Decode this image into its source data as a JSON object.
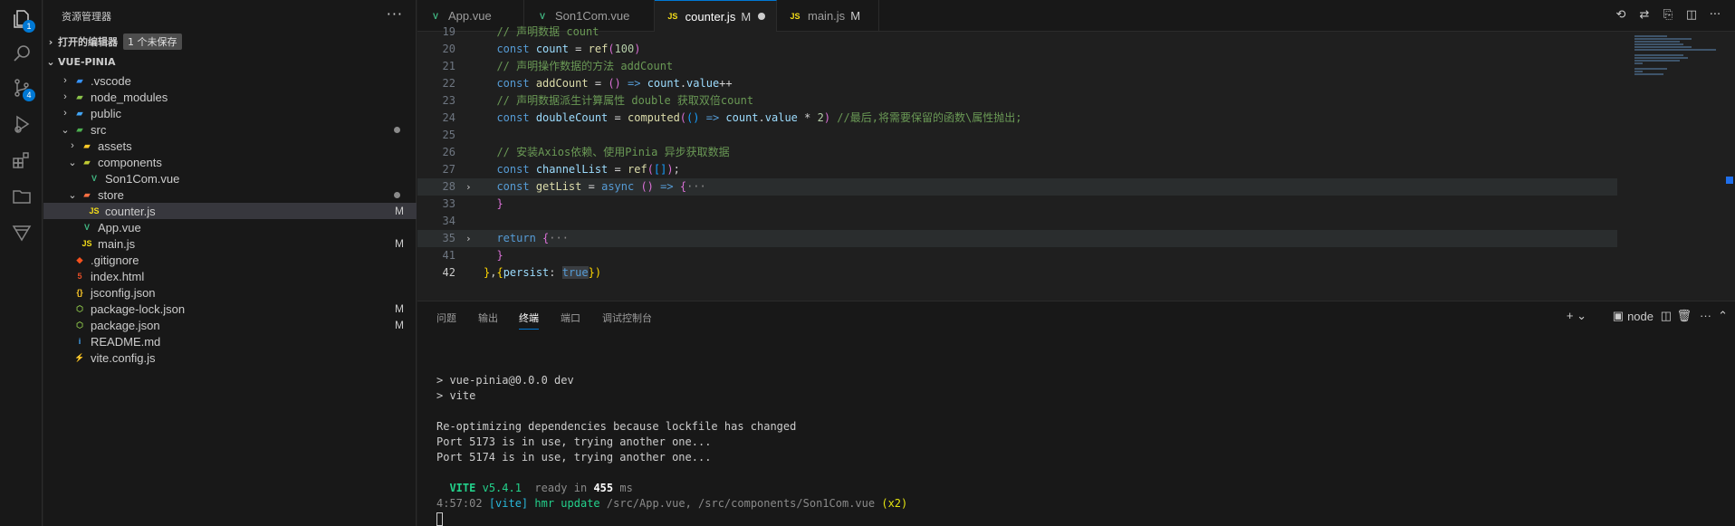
{
  "activity_bar": {
    "items": [
      {
        "icon": "files-icon",
        "badge": "1"
      },
      {
        "icon": "search-icon",
        "badge": ""
      },
      {
        "icon": "source-control-icon",
        "badge": "4"
      },
      {
        "icon": "run-debug-icon",
        "badge": ""
      },
      {
        "icon": "extensions-icon",
        "badge": ""
      },
      {
        "icon": "folder-icon",
        "badge": ""
      },
      {
        "icon": "vite-icon",
        "badge": ""
      }
    ]
  },
  "sidebar": {
    "title": "资源管理器",
    "more": "···",
    "open_editors": {
      "label": "打开的编辑器",
      "badge": "1 个未保存"
    },
    "project": "VUE-PINIA",
    "tree": [
      {
        "name": ".vscode",
        "chevron": "›",
        "icon": "▰",
        "icon_color": "#3794ff",
        "status": ""
      },
      {
        "name": "node_modules",
        "chevron": "›",
        "icon": "▰",
        "icon_color": "#8bc34a",
        "status": ""
      },
      {
        "name": "public",
        "chevron": "›",
        "icon": "▰",
        "icon_color": "#42a5f5",
        "status": ""
      },
      {
        "name": "src",
        "chevron": "⌄",
        "icon": "▰",
        "icon_color": "#4caf50",
        "status": "dot"
      },
      {
        "name": "assets",
        "chevron": "›",
        "icon": "▰",
        "icon_color": "#ffca28",
        "status": ""
      },
      {
        "name": "components",
        "chevron": "⌄",
        "icon": "▰",
        "icon_color": "#c0ca33",
        "status": ""
      },
      {
        "name": "Son1Com.vue",
        "chevron": "",
        "icon": "V",
        "icon_color": "#41b883",
        "status": ""
      },
      {
        "name": "store",
        "chevron": "⌄",
        "icon": "▰",
        "icon_color": "#ff7043",
        "status": "dot"
      },
      {
        "name": "counter.js",
        "chevron": "",
        "icon": "JS",
        "icon_color": "#f5de19",
        "status": "M"
      },
      {
        "name": "App.vue",
        "chevron": "",
        "icon": "V",
        "icon_color": "#41b883",
        "status": ""
      },
      {
        "name": "main.js",
        "chevron": "",
        "icon": "JS",
        "icon_color": "#f5de19",
        "status": "M"
      },
      {
        "name": ".gitignore",
        "chevron": "",
        "icon": "◆",
        "icon_color": "#f4511e",
        "status": ""
      },
      {
        "name": "index.html",
        "chevron": "",
        "icon": "5",
        "icon_color": "#e44d26",
        "status": ""
      },
      {
        "name": "jsconfig.json",
        "chevron": "",
        "icon": "{}",
        "icon_color": "#ffca28",
        "status": ""
      },
      {
        "name": "package-lock.json",
        "chevron": "",
        "icon": "⬡",
        "icon_color": "#8bc34a",
        "status": "M"
      },
      {
        "name": "package.json",
        "chevron": "",
        "icon": "⬡",
        "icon_color": "#8bc34a",
        "status": "M"
      },
      {
        "name": "README.md",
        "chevron": "",
        "icon": "i",
        "icon_color": "#42a5f5",
        "status": ""
      },
      {
        "name": "vite.config.js",
        "chevron": "",
        "icon": "⚡",
        "icon_color": "#ffca28",
        "status": ""
      }
    ]
  },
  "tabs": [
    {
      "label": "App.vue",
      "icon": "V",
      "icon_color": "#41b883",
      "modified": "",
      "active": false
    },
    {
      "label": "Son1Com.vue",
      "icon": "V",
      "icon_color": "#41b883",
      "modified": "",
      "active": false
    },
    {
      "label": "counter.js",
      "icon": "JS",
      "icon_color": "#f5de19",
      "modified": "M",
      "active": true
    },
    {
      "label": "main.js",
      "icon": "JS",
      "icon_color": "#f5de19",
      "modified": "M",
      "active": false
    }
  ],
  "editor": {
    "lines": [
      {
        "n": "19",
        "fold": "",
        "html": "  <span class='cm'>// 声明数据 count</span>"
      },
      {
        "n": "20",
        "fold": "",
        "html": "  <span class='kw'>const</span> <span class='var'>count</span> <span class='op'>=</span> <span class='fn'>ref</span><span class='br2'>(</span><span class='num'>100</span><span class='br2'>)</span>"
      },
      {
        "n": "21",
        "fold": "",
        "html": "  <span class='cm'>// 声明操作数据的方法 addCount</span>"
      },
      {
        "n": "22",
        "fold": "",
        "html": "  <span class='kw'>const</span> <span class='fn'>addCount</span> <span class='op'>=</span> <span class='br2'>()</span> <span class='kw'>=&gt;</span> <span class='var'>count</span>.<span class='var'>value</span><span class='op'>++</span>"
      },
      {
        "n": "23",
        "fold": "",
        "html": "  <span class='cm'>// 声明数据派生计算属性 double 获取双倍count</span>"
      },
      {
        "n": "24",
        "fold": "",
        "html": "  <span class='kw'>const</span> <span class='var'>doubleCount</span> <span class='op'>=</span> <span class='fn'>computed</span><span class='br2'>(</span><span class='br3'>()</span> <span class='kw'>=&gt;</span> <span class='var'>count</span>.<span class='var'>value</span> <span class='op'>*</span> <span class='num'>2</span><span class='br2'>)</span> <span class='cm'>//最后,将需要保留的函数\\属性抛出;</span>"
      },
      {
        "n": "25",
        "fold": "",
        "html": ""
      },
      {
        "n": "26",
        "fold": "",
        "html": "  <span class='cm'>// 安装Axios依赖、使用Pinia 异步获取数据</span>"
      },
      {
        "n": "27",
        "fold": "",
        "html": "  <span class='kw'>const</span> <span class='var'>channelList</span> <span class='op'>=</span> <span class='fn'>ref</span><span class='br2'>(</span><span class='br3'>[]</span><span class='br2'>)</span>;"
      },
      {
        "n": "28",
        "fold": "›",
        "html": "  <span class='kw'>const</span> <span class='fn'>getList</span> <span class='op'>=</span> <span class='kw'>async</span> <span class='br2'>()</span> <span class='kw'>=&gt;</span> <span class='br2'>{</span><span class='ell'>···</span>",
        "hl": true
      },
      {
        "n": "33",
        "fold": "",
        "html": "  <span class='br2'>}</span>"
      },
      {
        "n": "34",
        "fold": "",
        "html": ""
      },
      {
        "n": "35",
        "fold": "›",
        "html": "  <span class='kw'>return</span> <span class='br2'>{</span><span class='ell'>···</span>",
        "hl": true
      },
      {
        "n": "41",
        "fold": "",
        "html": "  <span class='br2'>}</span>"
      },
      {
        "n": "42",
        "fold": "",
        "html": "<span class='br1'>}</span>,<span class='br1'>{</span><span class='var'>persist</span>: <span class='kw' style='background:#3a3d41'>true</span><span class='br1'>}</span><span class='br1'>)</span>",
        "cur": true
      }
    ]
  },
  "panel": {
    "tabs": [
      {
        "label": "问题",
        "active": false
      },
      {
        "label": "输出",
        "active": false
      },
      {
        "label": "终端",
        "active": true
      },
      {
        "label": "端口",
        "active": false
      },
      {
        "label": "调试控制台",
        "active": false
      }
    ],
    "actions": {
      "add": "+ ⌄",
      "terminal_name": "node"
    },
    "terminal": [
      {
        "html": ""
      },
      {
        "html": "&gt; vue-pinia@0.0.0 dev"
      },
      {
        "html": "&gt; vite"
      },
      {
        "html": ""
      },
      {
        "html": "Re-optimizing dependencies because lockfile has changed"
      },
      {
        "html": "Port 5173 is in use, trying another one..."
      },
      {
        "html": "Port 5174 is in use, trying another one..."
      },
      {
        "html": ""
      },
      {
        "html": "  <span class='tl-green'>VITE</span> <span class='tl-green' style='font-weight:normal'>v5.4.1</span>  <span class='tl-dim'>ready in</span> <span class='tl-white'>455</span> <span class='tl-dim'>ms</span>"
      },
      {
        "html": "<span class='tl-dim'>4:57:02</span> <span class='tl-cyan'>[vite]</span> <span class='tl-green' style='font-weight:normal'>hmr update</span> <span class='tl-dim'>/src/App.vue, /src/components/Son1Com.vue</span> <span class='tl-yellow'>(x2)</span>"
      },
      {
        "html": "<span class='cursor'></span>"
      }
    ]
  }
}
